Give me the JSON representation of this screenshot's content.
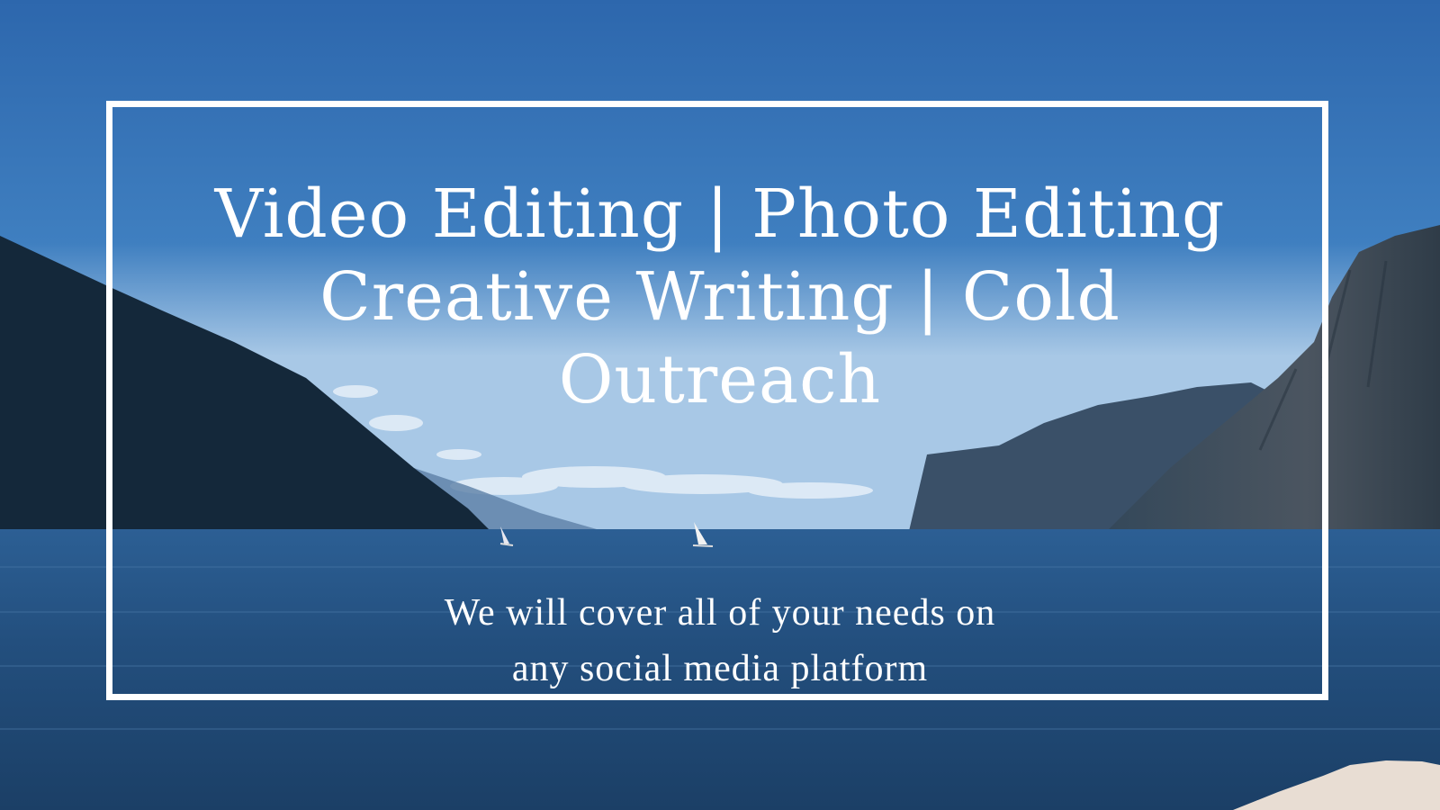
{
  "banner": {
    "headline_lines": [
      "Video Editing | Photo Editing",
      "Creative Writing | Cold",
      "Outreach"
    ],
    "subline_lines": [
      "We will cover all of your needs on",
      "any social media platform"
    ]
  },
  "colors": {
    "sky_top": "#2a66ae",
    "sky_horizon": "#9fc3e6",
    "lake": "#1f4f80",
    "mountain_dark": "#142638",
    "frame": "#ffffff",
    "text": "#ffffff"
  }
}
